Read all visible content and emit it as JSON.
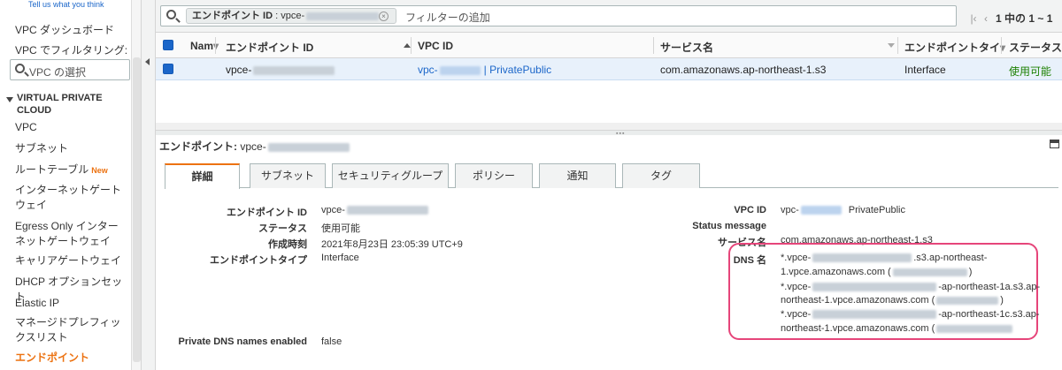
{
  "sidebar": {
    "top_link": "Tell us what you think",
    "dashboard": "VPC ダッシュボード",
    "filter_label": "VPC でフィルタリング:",
    "search_placeholder": "VPC の選択",
    "section": "VIRTUAL PRIVATE CLOUD",
    "items": [
      {
        "label": "VPC"
      },
      {
        "label": "サブネット"
      },
      {
        "label": "ルートテーブル",
        "badge": "New"
      },
      {
        "label": "インターネットゲートウェイ"
      },
      {
        "label": "Egress Only インターネットゲートウェイ"
      },
      {
        "label": "キャリアゲートウェイ"
      },
      {
        "label": "DHCP オプションセット"
      },
      {
        "label": "Elastic IP"
      },
      {
        "label": "マネージドプレフィックスリスト"
      },
      {
        "label": "エンドポイント",
        "active": true
      }
    ]
  },
  "toolbar": {
    "token_key": "エンドポイント ID",
    "token_value": "vpce-",
    "filter_placeholder": "フィルターの追加",
    "pagination": "1 中の 1 ~ 1"
  },
  "table": {
    "headers": [
      "Nam",
      "エンドポイント ID",
      "VPC ID",
      "サービス名",
      "エンドポイントタイ",
      "ステータス"
    ],
    "rows": [
      {
        "endpoint_id": "vpce-",
        "vpc_id": "vpc-",
        "vpc_name": "| PrivatePublic",
        "service": "com.amazonaws.ap-northeast-1.s3",
        "type": "Interface",
        "status": "使用可能"
      }
    ]
  },
  "detail": {
    "header_label": "エンドポイント:",
    "header_value": "vpce-",
    "tabs": [
      "詳細",
      "サブネット",
      "セキュリティグループ",
      "ポリシー",
      "通知",
      "タグ"
    ],
    "left": [
      {
        "label": "エンドポイント ID",
        "value": "vpce-"
      },
      {
        "label": "ステータス",
        "value": "使用可能"
      },
      {
        "label": "作成時刻",
        "value": "2021年8月23日 23:05:39 UTC+9"
      },
      {
        "label": "エンドポイントタイプ",
        "value": "Interface"
      },
      {
        "label": "Private DNS names enabled",
        "value": "false"
      }
    ],
    "right": {
      "vpc_label": "VPC ID",
      "vpc_value": "vpc-",
      "vpc_name": "PrivatePublic",
      "status_msg_label": "Status message",
      "service_label": "サービス名",
      "service_value": "com.amazonaws.ap-northeast-1.s3",
      "dns_label": "DNS 名",
      "dns_lines": [
        "*.vpce-",
        ".s3.ap-northeast-",
        "1.vpce.amazonaws.com (",
        ")",
        "*.vpce-",
        "-ap-northeast-1a.s3.ap-",
        "northeast-1.vpce.amazonaws.com (",
        ")",
        "*.vpce-",
        "-ap-northeast-1c.s3.ap-",
        "northeast-1.vpce.amazonaws.com ("
      ]
    }
  },
  "colors": {
    "accent": "#ec7211",
    "link": "#1b66c9",
    "ok": "#1d8102",
    "highlight": "#e6457a"
  }
}
